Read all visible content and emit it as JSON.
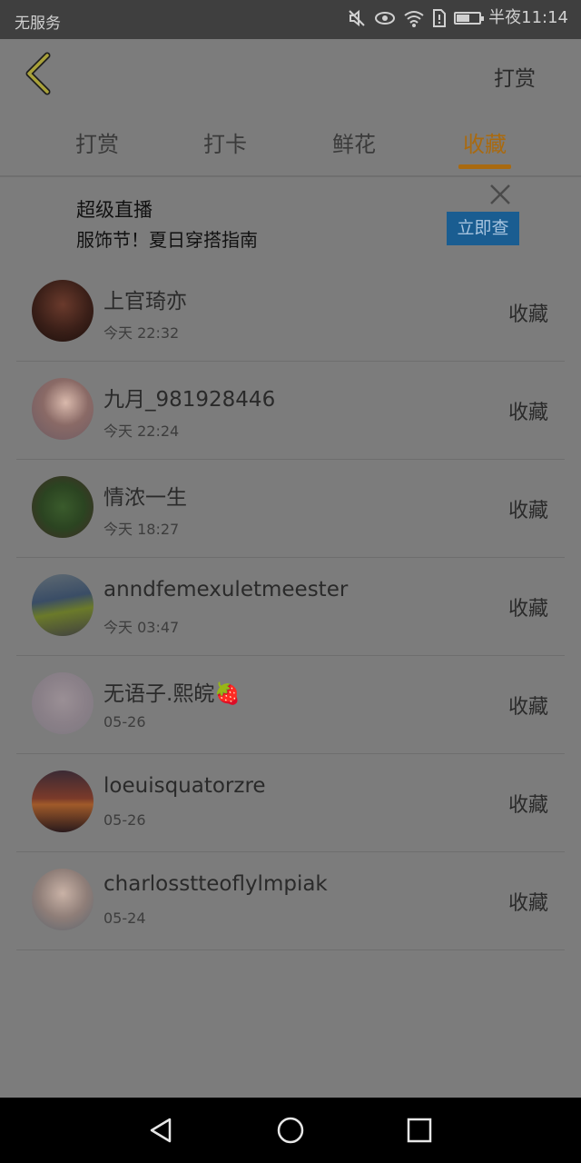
{
  "status_bar": {
    "carrier": "无服务",
    "time": "半夜11:14"
  },
  "header": {
    "action_label": "打赏"
  },
  "tabs": [
    {
      "label": "打赏",
      "active": false
    },
    {
      "label": "打卡",
      "active": false
    },
    {
      "label": "鲜花",
      "active": false
    },
    {
      "label": "收藏",
      "active": true
    }
  ],
  "ad": {
    "title": "超级直播",
    "subtitle": "服饰节！夏日穿搭指南",
    "button_label": "立即查"
  },
  "list": {
    "items": [
      {
        "name": "上官琦亦",
        "time": "今天  22:32",
        "action": "收藏"
      },
      {
        "name": "九月_981928446",
        "time": "今天  22:24",
        "action": "收藏"
      },
      {
        "name": "情浓一生",
        "time": "今天  18:27",
        "action": "收藏"
      },
      {
        "name": "anndfemexuletmeester",
        "time": "今天  03:47",
        "action": "收藏"
      },
      {
        "name": "无语子.熙皖🍓",
        "time": "05-26",
        "action": "收藏"
      },
      {
        "name": "loeuisquatorzre",
        "time": "05-26",
        "action": "收藏"
      },
      {
        "name": "charlosstteoflylmpiak",
        "time": "05-24",
        "action": "收藏"
      }
    ]
  },
  "colors": {
    "accent": "#a96a10",
    "ad_button": "#1a5d91",
    "overlay_bg": "#7c7c7c"
  }
}
